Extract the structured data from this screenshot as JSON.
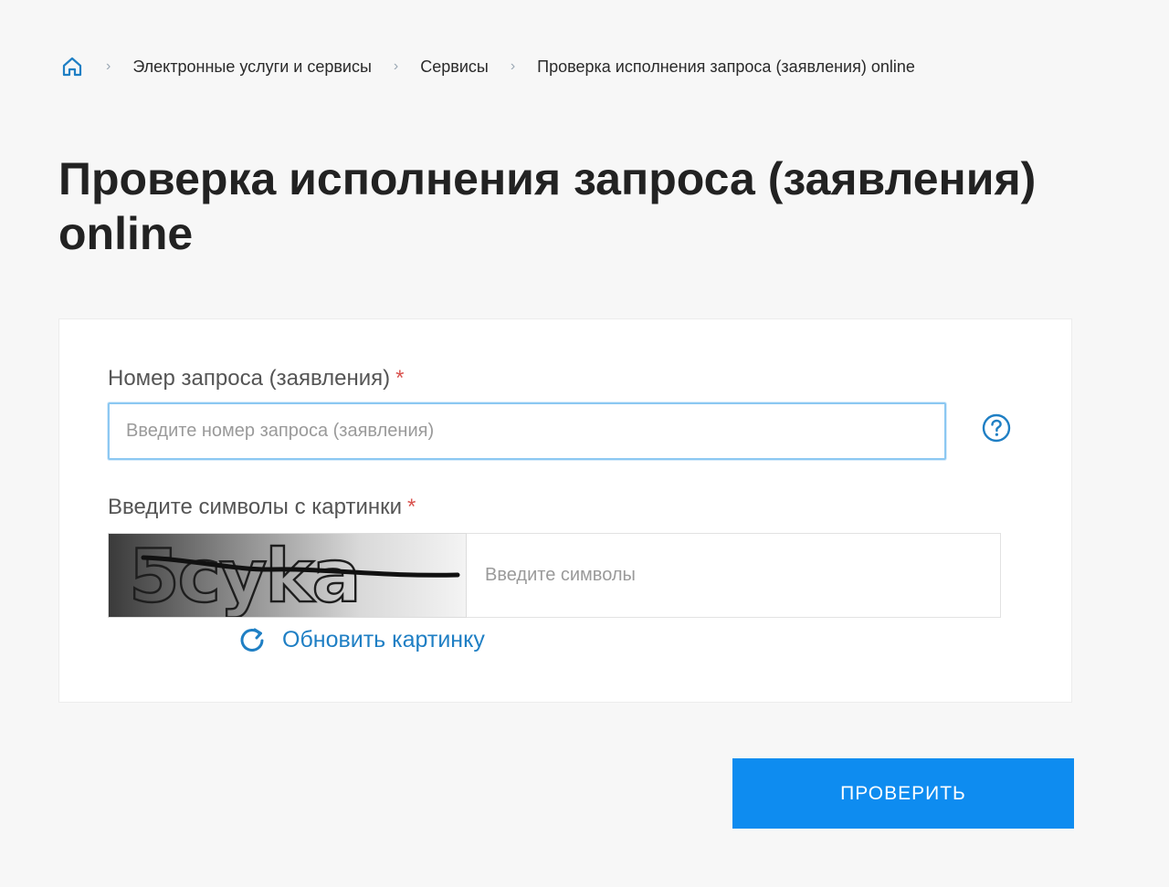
{
  "breadcrumb": {
    "home_icon": "home-icon",
    "separator": "›",
    "items": [
      {
        "label": "Электронные услуги и сервисы"
      },
      {
        "label": "Сервисы"
      }
    ],
    "current": "Проверка исполнения запроса (заявления) online"
  },
  "page": {
    "title": "Проверка исполнения запроса (заявления) online"
  },
  "form": {
    "request_number": {
      "label": "Номер запроса (заявления)",
      "required_mark": "*",
      "value": "",
      "placeholder": "Введите номер запроса (заявления)",
      "help_icon": "question-circle-icon"
    },
    "captcha": {
      "label": "Введите символы с картинки",
      "required_mark": "*",
      "image_text": "5cyka",
      "value": "",
      "placeholder": "Введите символы"
    },
    "refresh": {
      "label": "Обновить картинку",
      "icon": "refresh-icon"
    },
    "submit_label": "ПРОВЕРИТЬ"
  },
  "colors": {
    "accent": "#0e8cf0",
    "link": "#1f7fc4",
    "required": "#d9534f",
    "background": "#f7f7f7"
  }
}
